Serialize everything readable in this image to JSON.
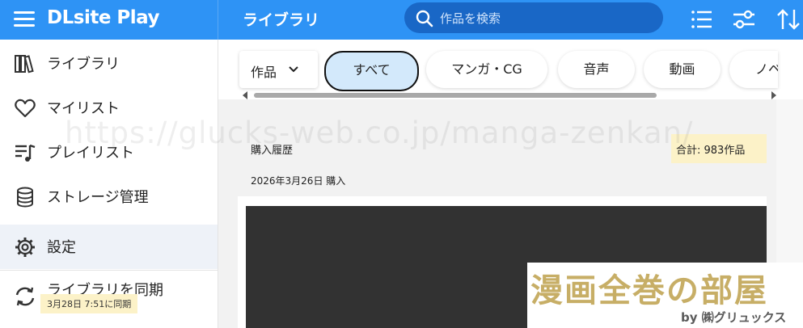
{
  "app": {
    "brand": "DLsite Play",
    "page_title": "ライブラリ"
  },
  "search": {
    "placeholder": "作品を検索"
  },
  "toolbar": {
    "icons": [
      "list-icon",
      "filter-settings-icon",
      "sort-icon"
    ]
  },
  "sidebar": {
    "items": [
      {
        "label": "ライブラリ",
        "icon": "books-icon"
      },
      {
        "label": "マイリスト",
        "icon": "heart-icon"
      },
      {
        "label": "プレイリスト",
        "icon": "playlist-icon"
      },
      {
        "label": "ストレージ管理",
        "icon": "database-icon"
      },
      {
        "label": "設定",
        "icon": "gear-icon",
        "active": true
      }
    ],
    "sync": {
      "label": "ライブラリを同期",
      "last_sync": "3月28日 7:51に同期",
      "icon": "sync-icon"
    }
  },
  "filters": {
    "type_dropdown": "作品",
    "chips": [
      "すべて",
      "マンガ・CG",
      "音声",
      "動画",
      "ノベル"
    ],
    "selected": "すべて"
  },
  "library": {
    "section_title": "購入履歴",
    "total": "合計: 983作品",
    "date_label": "2026年3月26日 購入"
  },
  "watermark": {
    "url": "https://glucks-web.co.jp/manga-zenkan/",
    "logo_main": "漫画全巻の部屋",
    "logo_sub": "by ㈱グリュックス"
  },
  "colors": {
    "topbar": "#2e93f5",
    "search": "#1967c6",
    "chip_selected": "#d3e9fb",
    "badge": "#fcf2c8"
  }
}
